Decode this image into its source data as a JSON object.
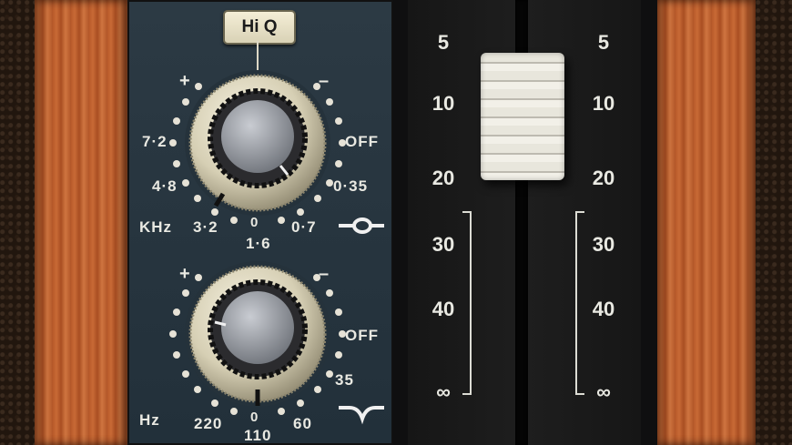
{
  "hiq_button": {
    "label": "Hi Q"
  },
  "upper_band": {
    "plus": "+",
    "minus": "–",
    "freq_labels": [
      "7·2",
      "4·8",
      "3·2",
      "1·6",
      "0·7",
      "0·35",
      "OFF"
    ],
    "gain_zero": "0",
    "unit": "KHz"
  },
  "lower_band": {
    "plus": "+",
    "minus": "–",
    "freq_labels": [
      "220",
      "110",
      "60",
      "35",
      "OFF"
    ],
    "gain_zero": "0",
    "unit": "Hz"
  },
  "fader_scale": {
    "left": [
      "5",
      "10",
      "20",
      "30",
      "40",
      "∞"
    ],
    "right": [
      "5",
      "10",
      "20",
      "30",
      "40",
      "∞"
    ]
  }
}
